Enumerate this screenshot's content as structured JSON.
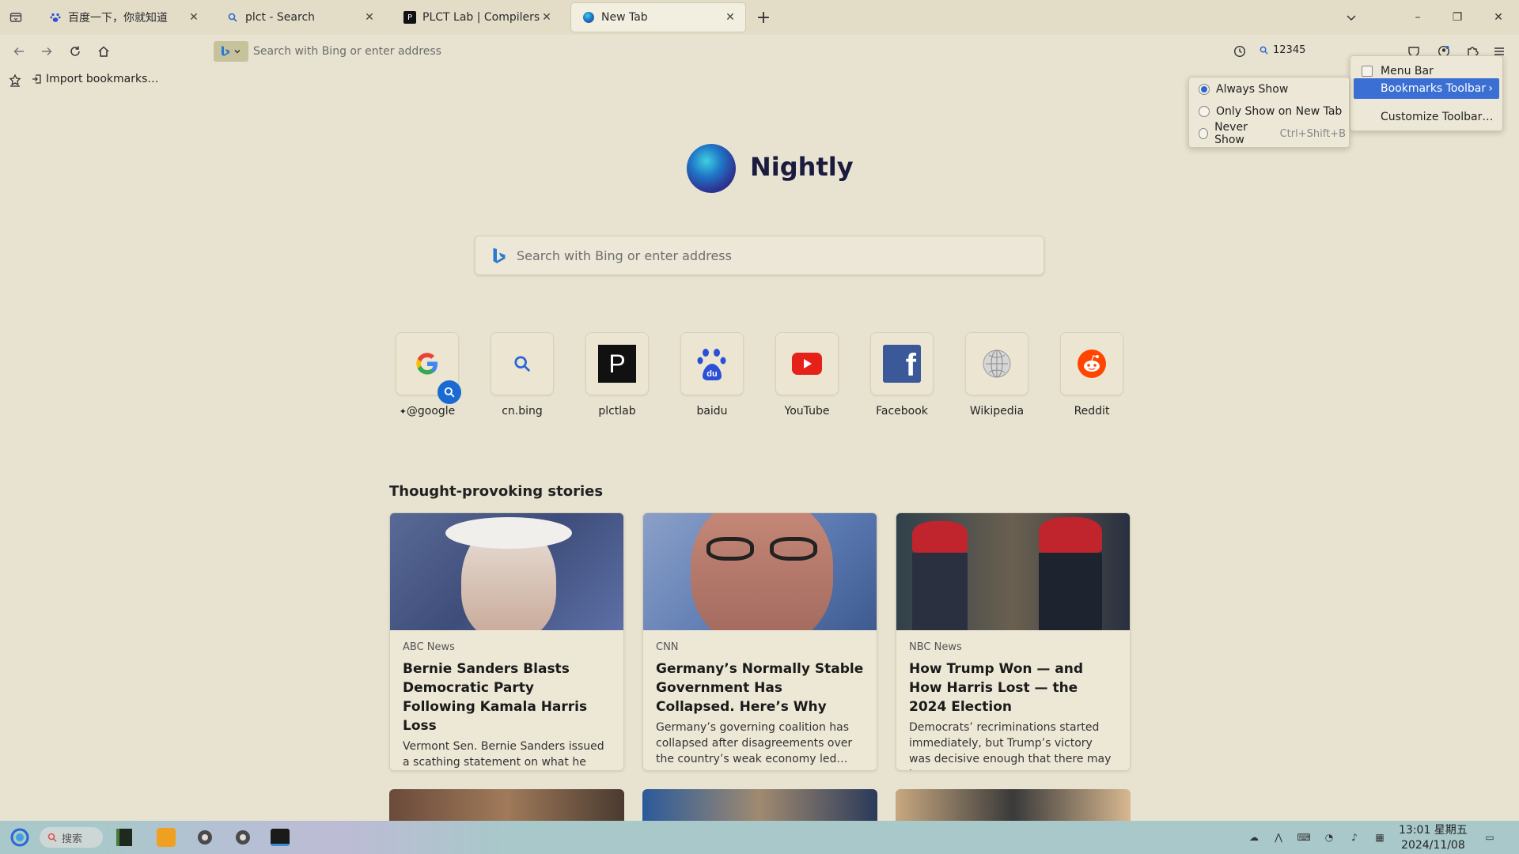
{
  "browser": {
    "tabs": [
      {
        "label": "百度一下，你就知道",
        "favicon": "paw-icon",
        "active": false
      },
      {
        "label": "plct - Search",
        "favicon": "search-icon",
        "active": false
      },
      {
        "label": "PLCT Lab | Compilers, Runt",
        "favicon": "P",
        "active": false
      },
      {
        "label": "New Tab",
        "favicon": "nightly-icon",
        "active": true
      }
    ],
    "new_tab_button": "+",
    "window_controls": {
      "minimize": "–",
      "restore": "❐",
      "close": "✕"
    }
  },
  "navbar": {
    "url_placeholder": "Search with Bing or enter address",
    "search_chip": "12345"
  },
  "bookmarks_bar": {
    "import_label": "Import bookmarks…"
  },
  "newtab": {
    "brand": "Nightly",
    "search_placeholder": "Search with Bing or enter address",
    "shortcuts": [
      {
        "title": "@google",
        "icon": "google-icon",
        "pinned": true
      },
      {
        "title": "cn.bing",
        "icon": "search-icon"
      },
      {
        "title": "plctlab",
        "icon": "P"
      },
      {
        "title": "baidu",
        "icon": "du"
      },
      {
        "title": "YouTube",
        "icon": "youtube-icon"
      },
      {
        "title": "Facebook",
        "icon": "f"
      },
      {
        "title": "Wikipedia",
        "icon": "wikipedia-globe-icon"
      },
      {
        "title": "Reddit",
        "icon": "reddit-icon"
      }
    ],
    "stories_title": "Thought-provoking stories",
    "stories": [
      {
        "source": "ABC News",
        "headline": "Bernie Sanders Blasts Democratic Party Following Kamala Harris Loss",
        "excerpt": "Vermont Sen. Bernie Sanders issued a scathing statement on what he called the Democratic Party’s “disastrous…"
      },
      {
        "source": "CNN",
        "headline": "Germany’s Normally Stable Government Has Collapsed. Here’s Why",
        "excerpt": "Germany’s governing coalition has collapsed after disagreements over the country’s weak economy led…"
      },
      {
        "source": "NBC News",
        "headline": "How Trump Won — and How Harris Lost — the 2024 Election",
        "excerpt": "Democrats’ recriminations started immediately, but Trump’s victory was decisive enough that there may have…"
      }
    ]
  },
  "context_menu": {
    "items": [
      {
        "label": "Menu Bar",
        "checked": false
      },
      {
        "label": "Bookmarks Toolbar",
        "submenu": true,
        "highlighted": true
      },
      {
        "label": "Customize Toolbar…"
      }
    ],
    "submenu": [
      {
        "label": "Always Show",
        "selected": true
      },
      {
        "label": "Only Show on New Tab",
        "selected": false
      },
      {
        "label": "Never Show",
        "accel": "Ctrl+Shift+B",
        "selected": false
      }
    ]
  },
  "taskbar": {
    "search_label": "搜索",
    "time": "13:01 星期五",
    "date": "2024/11/08"
  },
  "colors": {
    "background": "#e8e3d0",
    "menu_highlight": "#3b6fd4",
    "taskbar": "#a8c8c9"
  }
}
